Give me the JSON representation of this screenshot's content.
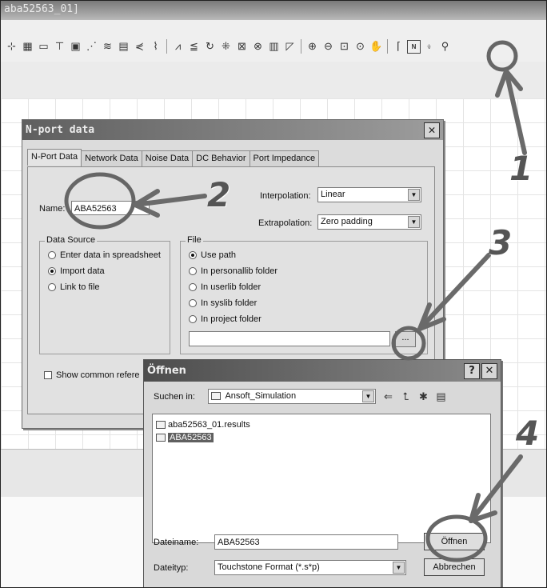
{
  "window": {
    "title": "aba52563_01]"
  },
  "n_port_dialog": {
    "title": "N-port data",
    "tabs": [
      "N-Port Data",
      "Network Data",
      "Noise Data",
      "DC Behavior",
      "Port Impedance"
    ],
    "name_label": "Name:",
    "name_value": "ABA52563",
    "interpolation_label": "Interpolation:",
    "interpolation_value": "Linear",
    "extrapolation_label": "Extrapolation:",
    "extrapolation_value": "Zero padding",
    "data_source": {
      "title": "Data Source",
      "options": [
        "Enter data in spreadsheet",
        "Import data",
        "Link to file"
      ],
      "selected_index": 1
    },
    "file": {
      "title": "File",
      "options": [
        "Use path",
        "In personallib folder",
        "In userlib folder",
        "In syslib folder",
        "In project folder"
      ],
      "selected_index": 0,
      "path_value": "",
      "browse_label": "..."
    },
    "show_common_ref_label": "Show common refere"
  },
  "open_dialog": {
    "title": "Öffnen",
    "help_label": "?",
    "close_label": "✕",
    "look_in_label": "Suchen in:",
    "look_in_value": "Ansoft_Simulation",
    "files": [
      {
        "name": "aba52563_01.results",
        "type": "folder"
      },
      {
        "name": "ABA52563",
        "type": "file",
        "selected": true
      }
    ],
    "filename_label": "Dateiname:",
    "filename_value": "ABA52563",
    "filetype_label": "Dateityp:",
    "filetype_value": "Touchstone Format (*.s*p)",
    "open_button": "Öffnen",
    "cancel_button": "Abbrechen"
  },
  "annotations": {
    "n1": "1",
    "n2": "2",
    "n3": "3",
    "n4": "4"
  }
}
